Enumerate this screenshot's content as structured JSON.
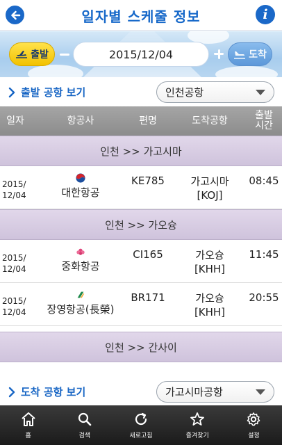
{
  "header": {
    "title": "일자별 스케줄 정보",
    "back_icon": "back-arrow-icon",
    "info_icon": "info-icon",
    "info_glyph": "i",
    "accent_color": "#1a68c8"
  },
  "date_selector": {
    "depart_label": "출발",
    "arrive_label": "도착",
    "date": "2015/12/04"
  },
  "departure_airport": {
    "link_label": "출발 공항 보기",
    "selected": "인천공항"
  },
  "arrival_airport": {
    "link_label": "도착 공항 보기",
    "selected": "가고시마공항"
  },
  "table": {
    "columns": [
      "일자",
      "항공사",
      "편명",
      "도착공항",
      "출발\n시간"
    ],
    "groups": [
      {
        "route": "인천 >> 가고시마",
        "flights": [
          {
            "date_line1": "2015/",
            "date_line2": "12/04",
            "airline": "대한항공",
            "flight": "KE785",
            "dest_line1": "가고시마",
            "dest_line2": "[KOJ]",
            "time": "08:45"
          }
        ]
      },
      {
        "route": "인천 >> 가오슝",
        "flights": [
          {
            "date_line1": "2015/",
            "date_line2": "12/04",
            "airline": "중화항공",
            "flight": "CI165",
            "dest_line1": "가오슝",
            "dest_line2": "[KHH]",
            "time": "11:45"
          },
          {
            "date_line1": "2015/",
            "date_line2": "12/04",
            "airline": "장영항공(長榮)",
            "flight": "BR171",
            "dest_line1": "가오슝",
            "dest_line2": "[KHH]",
            "time": "20:55"
          }
        ]
      },
      {
        "route": "인천 >> 간사이",
        "flights": []
      }
    ]
  },
  "bottom_nav": [
    {
      "label": "홈",
      "icon": "home-icon"
    },
    {
      "label": "검색",
      "icon": "search-icon"
    },
    {
      "label": "새로고침",
      "icon": "refresh-icon"
    },
    {
      "label": "즐겨찾기",
      "icon": "star-icon"
    },
    {
      "label": "설정",
      "icon": "gear-icon"
    }
  ]
}
